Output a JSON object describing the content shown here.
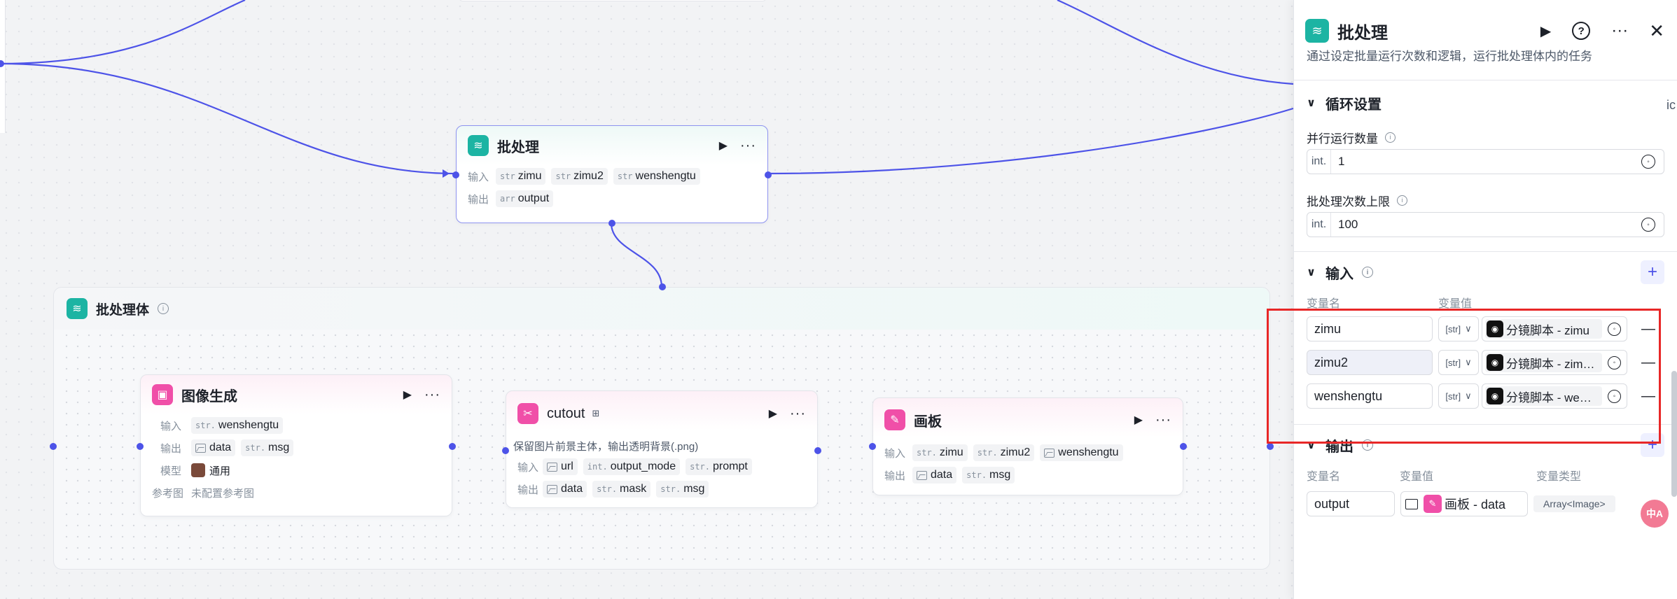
{
  "canvas": {
    "batch_node": {
      "title": "批处理",
      "input_label": "输入",
      "output_label": "输出",
      "inputs": [
        {
          "type": "str",
          "name": "zimu"
        },
        {
          "type": "str",
          "name": "zimu2"
        },
        {
          "type": "str",
          "name": "wenshengtu"
        }
      ],
      "outputs": [
        {
          "type": "arr",
          "name": "output"
        }
      ]
    },
    "batch_body": {
      "title": "批处理体"
    },
    "image_gen_node": {
      "title": "图像生成",
      "input_label": "输入",
      "output_label": "输出",
      "model_label": "模型",
      "ref_label": "参考图",
      "input_tag": {
        "type": "str.",
        "name": "wenshengtu"
      },
      "output_tags": [
        {
          "type": "img",
          "name": "data"
        },
        {
          "type": "str.",
          "name": "msg"
        }
      ],
      "model_value": "通用",
      "ref_value": "未配置参考图"
    },
    "cutout_node": {
      "title": "cutout",
      "description": "保留图片前景主体，输出透明背景(.png)",
      "input_label": "输入",
      "output_label": "输出",
      "inputs": [
        {
          "type": "img",
          "name": "url"
        },
        {
          "type": "int.",
          "name": "output_mode"
        },
        {
          "type": "str.",
          "name": "prompt"
        }
      ],
      "outputs": [
        {
          "type": "img",
          "name": "data"
        },
        {
          "type": "str.",
          "name": "mask"
        },
        {
          "type": "str.",
          "name": "msg"
        }
      ]
    },
    "canvas_node": {
      "title": "画板",
      "input_label": "输入",
      "output_label": "输出",
      "inputs": [
        {
          "type": "str.",
          "name": "zimu"
        },
        {
          "type": "str.",
          "name": "zimu2"
        },
        {
          "type": "img",
          "name": "wenshengtu"
        }
      ],
      "outputs": [
        {
          "type": "img",
          "name": "data"
        },
        {
          "type": "str.",
          "name": "msg"
        }
      ]
    }
  },
  "panel": {
    "title": "批处理",
    "description": "通过设定批量运行次数和逻辑，运行批处理体内的任务",
    "loop_section": "循环设置",
    "parallel_label": "并行运行数量",
    "parallel_prefix": "int.",
    "parallel_value": "1",
    "limit_label": "批处理次数上限",
    "limit_prefix": "int.",
    "limit_value": "100",
    "input_section": "输入",
    "col_name": "变量名",
    "col_value": "变量值",
    "col_type": "变量类型",
    "input_vars": [
      {
        "name": "zimu",
        "type": "[str]",
        "ref": "分镜脚本 - zimu"
      },
      {
        "name": "zimu2",
        "type": "[str]",
        "ref": "分镜脚本 - zim…"
      },
      {
        "name": "wenshengtu",
        "type": "[str]",
        "ref": "分镜脚本 - we…"
      }
    ],
    "output_section": "输出",
    "output_vars": [
      {
        "name": "output",
        "ref": "画板 - data",
        "type": "Array<Image>"
      }
    ]
  },
  "overlay": {
    "badge": "中A",
    "side_peek": "ic"
  },
  "colors": {
    "edge": "#4d53e8",
    "teal": "#1cb4a3",
    "pink": "#f04fa8",
    "highlight": "#e82727"
  }
}
